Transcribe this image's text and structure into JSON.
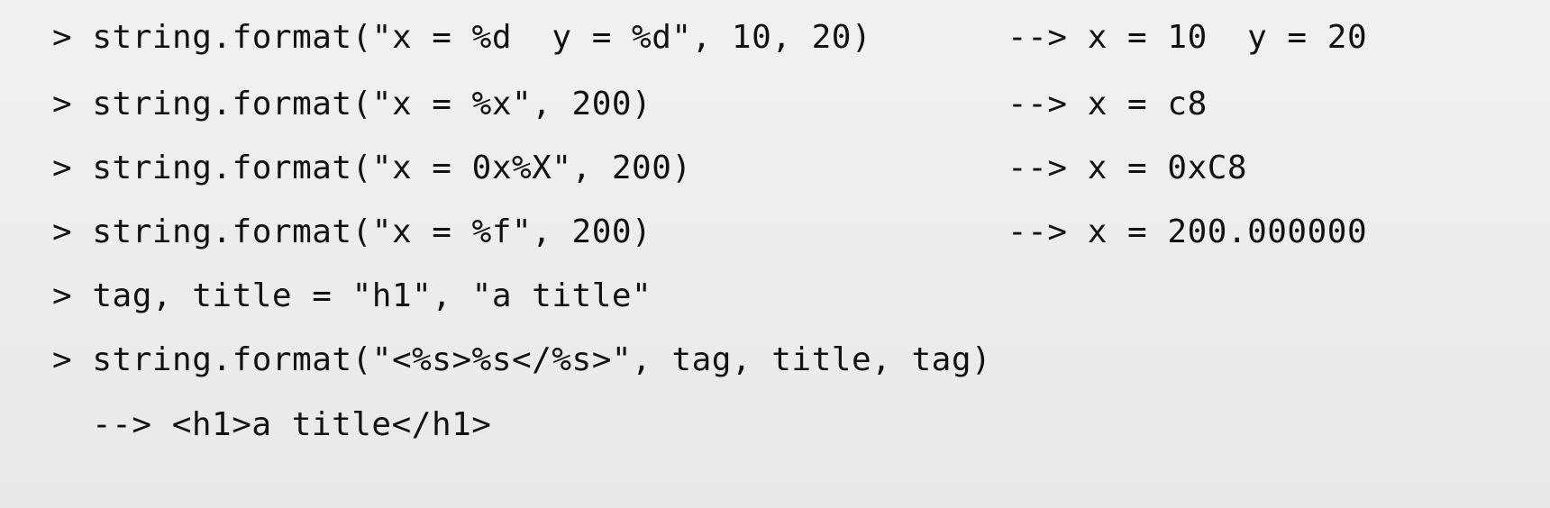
{
  "code": {
    "lines": [
      "> string.format(\"x = %d  y = %d\", 10, 20)",
      "> string.format(\"x = %x\", 200)",
      "> string.format(\"x = 0x%X\", 200)",
      "> string.format(\"x = %f\", 200)",
      "> tag, title = \"h1\", \"a title\"",
      "> string.format(\"<%s>%s</%s>\", tag, title, tag)",
      "--> <h1>a title</h1>"
    ],
    "outputs": [
      "--> x = 10  y = 20",
      "--> x = c8",
      "--> x = 0xC8",
      "--> x = 200.000000"
    ]
  }
}
